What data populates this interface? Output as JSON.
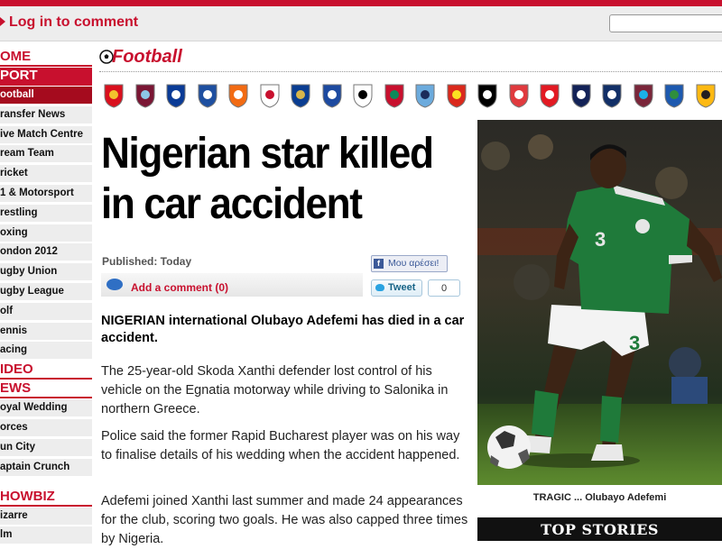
{
  "header": {
    "login_link": "Log in to comment",
    "search_placeholder": ""
  },
  "nav": {
    "sections": [
      {
        "label": "OME",
        "active": false
      },
      {
        "label": "PORT",
        "active": true
      }
    ],
    "sport_items": [
      "ootball",
      "ransfer News",
      "ive Match Centre",
      "ream Team",
      "ricket",
      "1 & Motorsport",
      "restling",
      "oxing",
      "ondon 2012",
      "ugby Union",
      "ugby League",
      "olf",
      "ennis",
      "acing"
    ],
    "video": "IDEO",
    "news": "EWS",
    "news_items": [
      "oyal Wedding",
      "orces",
      "un City",
      "aptain Crunch"
    ],
    "showbiz": "HOWBIZ",
    "showbiz_items": [
      "izarre",
      "lm"
    ]
  },
  "section_title": "Football",
  "badges": [
    {
      "name": "arsenal-badge-icon",
      "color": "#d9101e",
      "accent": "#f2c22d"
    },
    {
      "name": "aston-villa-badge-icon",
      "color": "#7a1634",
      "accent": "#8dc6e8"
    },
    {
      "name": "birmingham-badge-icon",
      "color": "#0a3b96",
      "accent": "#ffffff"
    },
    {
      "name": "blackburn-badge-icon",
      "color": "#1e4fa0",
      "accent": "#ffffff"
    },
    {
      "name": "blackpool-badge-icon",
      "color": "#f26b13",
      "accent": "#ffffff"
    },
    {
      "name": "bolton-badge-icon",
      "color": "#ffffff",
      "accent": "#c8102e"
    },
    {
      "name": "chelsea-badge-icon",
      "color": "#0a3d91",
      "accent": "#d7b54a"
    },
    {
      "name": "everton-badge-icon",
      "color": "#1d4aa0",
      "accent": "#ffffff"
    },
    {
      "name": "fulham-badge-icon",
      "color": "#ffffff",
      "accent": "#000000"
    },
    {
      "name": "liverpool-badge-icon",
      "color": "#c8102e",
      "accent": "#0d8a5a"
    },
    {
      "name": "man-city-badge-icon",
      "color": "#6cabdd",
      "accent": "#1c2c5b"
    },
    {
      "name": "man-utd-badge-icon",
      "color": "#da291c",
      "accent": "#fbe122"
    },
    {
      "name": "newcastle-badge-icon",
      "color": "#000000",
      "accent": "#ffffff"
    },
    {
      "name": "stoke-badge-icon",
      "color": "#e03a3e",
      "accent": "#ffffff"
    },
    {
      "name": "sunderland-badge-icon",
      "color": "#e21a23",
      "accent": "#ffffff"
    },
    {
      "name": "tottenham-badge-icon",
      "color": "#132257",
      "accent": "#ffffff"
    },
    {
      "name": "west-brom-badge-icon",
      "color": "#122f67",
      "accent": "#ffffff"
    },
    {
      "name": "west-ham-badge-icon",
      "color": "#7a263a",
      "accent": "#1bb1e7"
    },
    {
      "name": "wigan-badge-icon",
      "color": "#1d59af",
      "accent": "#2f8f3c"
    },
    {
      "name": "wolves-badge-icon",
      "color": "#fdb913",
      "accent": "#231f20"
    }
  ],
  "article": {
    "headline": "Nigerian star killed in car accident",
    "published": "Published: Today",
    "add_comment": "Add a comment (0)",
    "fb_like": "Μου αρέσει!",
    "tweet": "Tweet",
    "tweet_count": "0",
    "lede": "NIGERIAN international Olubayo Adefemi has died in a car accident.",
    "paragraphs": [
      "The 25-year-old Skoda Xanthi defender lost control of his vehicle on the Egnatia motorway while driving to Salonika in northern Greece.",
      "Police said the former Rapid Bucharest player was on his way to finalise details of his wedding when the accident happened.",
      "Adefemi joined Xanthi last summer and made 24 appearances for the club, scoring two goals. He was also capped three times by Nigeria."
    ],
    "photo_caption": "TRAGIC ... Olubayo Adefemi",
    "jersey_number": "3"
  },
  "sidebar": {
    "top_stories": "TOP STORIES"
  },
  "colors": {
    "brand_red": "#c8102e",
    "nav_bg": "#ededed"
  }
}
